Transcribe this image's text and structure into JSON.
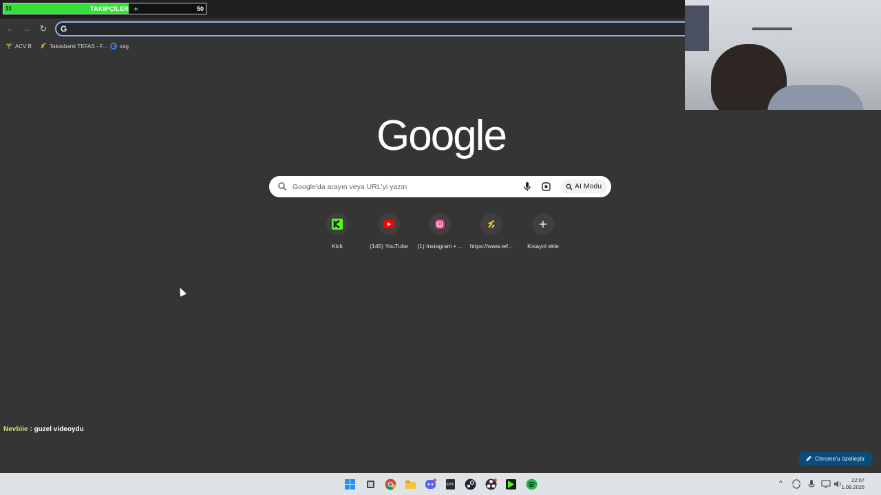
{
  "overlay": {
    "follower_current": "31",
    "follower_label": "TAKİPÇİLER",
    "follower_plus": "+",
    "follower_goal": "50",
    "follower_progress": 0.62,
    "chat_user": "Nevbiie",
    "chat_sep": " : ",
    "chat_message": "guzel videoydu"
  },
  "toolbar": {
    "back_icon": "back-arrow-icon",
    "forward_icon": "forward-arrow-icon",
    "reload_icon": "reload-icon",
    "omnibox_prefix": "G",
    "omnibox_value": ""
  },
  "bookmarks": [
    {
      "label": "ACV B",
      "icon": "plant-icon"
    },
    {
      "label": "Takasbank TEFAS - F...",
      "icon": "tefas-icon"
    },
    {
      "label": "sag",
      "icon": "google-icon"
    }
  ],
  "newtab": {
    "logo": "Google",
    "search_placeholder": "Google'da arayın veya URL'yi yazın",
    "ai_mode": "AI Modu",
    "shortcuts": [
      {
        "label": "Kick",
        "icon": "kick-icon",
        "color": "#53fc18"
      },
      {
        "label": "(145) YouTube",
        "icon": "youtube-icon",
        "color": "#ff0000"
      },
      {
        "label": "(1) Instagram • ...",
        "icon": "instagram-icon",
        "color": "#e1306c"
      },
      {
        "label": "https://www.tef...",
        "icon": "tefas-icon",
        "color": "#f4c20d"
      },
      {
        "label": "Kısayol ekle",
        "icon": "plus-icon",
        "color": "#e3e3e3"
      }
    ],
    "customize": "Chrome'u özelleştir"
  },
  "taskbar": {
    "apps": [
      "windows-start-icon",
      "task-view-icon",
      "chrome-icon",
      "file-explorer-icon",
      "discord-icon",
      "epic-games-icon",
      "steam-icon",
      "obs-icon",
      "game-launcher-icon",
      "spotify-icon"
    ],
    "tray_caret": "^",
    "time": "22:07",
    "date": "1.08.2026"
  },
  "colors": {
    "background": "#353535",
    "accent": "#8ab4f8",
    "progress_green": "#33e03a"
  }
}
